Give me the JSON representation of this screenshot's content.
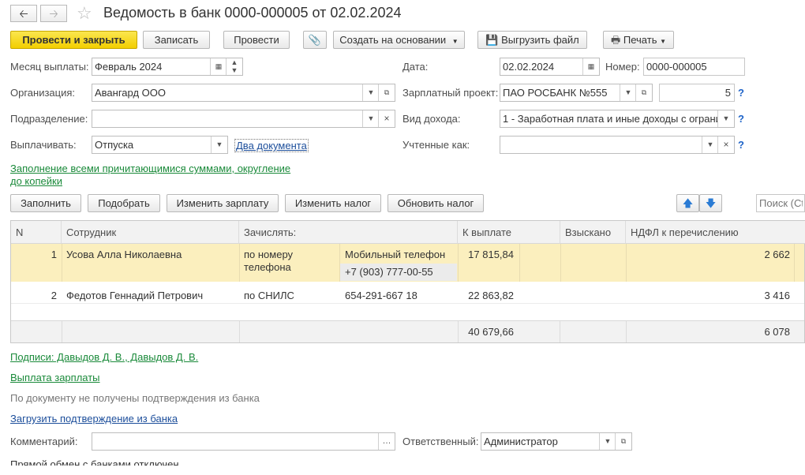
{
  "header": {
    "back_icon": "arrow-left-icon",
    "forward_icon": "arrow-right-icon",
    "star_icon": "star-icon",
    "title": "Ведомость в банк 0000-000005 от 02.02.2024"
  },
  "toolbar": {
    "post_close": "Провести и закрыть",
    "save": "Записать",
    "post": "Провести",
    "create_based": "Создать на основании",
    "upload": "Выгрузить файл",
    "print": "Печать"
  },
  "form": {
    "month_label": "Месяц выплаты:",
    "month_value": "Февраль 2024",
    "date_label": "Дата:",
    "date_value": "02.02.2024",
    "number_label": "Номер:",
    "number_value": "0000-000005",
    "org_label": "Организация:",
    "org_value": "Авангард ООО",
    "project_label": "Зарплатный проект:",
    "project_value": "ПАО РОСБАНК №555",
    "project_num": "5",
    "division_label": "Подразделение:",
    "division_value": "",
    "income_label": "Вид дохода:",
    "income_value": "1 - Заработная плата и иные доходы с ограни",
    "pay_label": "Выплачивать:",
    "pay_value": "Отпуска",
    "two_docs": "Два документа",
    "counted_label": "Учтенные как:",
    "counted_value": "",
    "fill_link": "Заполнение всеми причитающимися суммами, округление",
    "fill_link2": "до копейки"
  },
  "table_toolbar": {
    "fill": "Заполнить",
    "pick": "Подобрать",
    "change_salary": "Изменить зарплату",
    "change_tax": "Изменить налог",
    "update_tax": "Обновить налог",
    "search_placeholder": "Поиск (Ctrl+F)"
  },
  "table": {
    "headers": [
      "N",
      "Сотрудник",
      "Зачислять:",
      "К выплате",
      "Взыскано",
      "НДФЛ к перечислению"
    ],
    "rows": [
      {
        "n": "1",
        "employee": "Усова Алла Николаевна",
        "method": "по номеру телефона",
        "method_l1": "по номеру",
        "method_l2": "телефона",
        "detail1": "Мобильный телефон",
        "detail2": "+7 (903) 777-00-55",
        "pay": "17 815,84",
        "collected": "",
        "ndfl": "2 662"
      },
      {
        "n": "2",
        "employee": "Федотов Геннадий Петрович",
        "method": "по СНИЛС",
        "detail1": "654-291-667 18",
        "pay": "22 863,82",
        "collected": "",
        "ndfl": "3 416"
      }
    ],
    "total_pay": "40 679,66",
    "total_ndfl": "6 078"
  },
  "footer": {
    "signatures": "Подписи: Давыдов Д. В., Давыдов Д. В.",
    "salary_payment": "Выплата зарплаты",
    "no_confirm": "По документу не получены подтверждения из банка",
    "load_confirm": "Загрузить подтверждение из банка",
    "comment_label": "Комментарий:",
    "comment_value": "",
    "responsible_label": "Ответственный:",
    "responsible_value": "Администратор",
    "direct_exchange": "Прямой обмен с банками отключен"
  }
}
